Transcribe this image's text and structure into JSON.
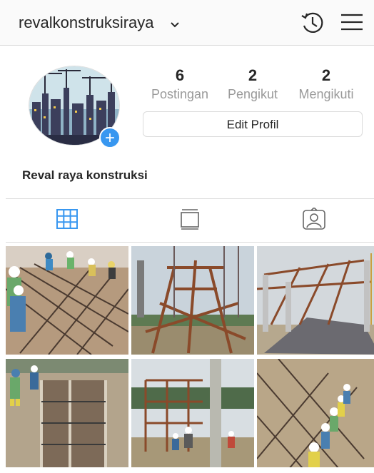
{
  "header": {
    "username": "revalkonstruksiraya"
  },
  "icons": {
    "chevron": "chevron-down-icon",
    "history": "history-icon",
    "menu": "hamburger-menu-icon",
    "add_story": "plus-icon",
    "grid_tab": "grid-icon",
    "igtv_tab": "tv-icon",
    "tagged_tab": "tagged-person-icon"
  },
  "profile": {
    "stats": [
      {
        "value": "6",
        "label": "Postingan"
      },
      {
        "value": "2",
        "label": "Pengikut"
      },
      {
        "value": "2",
        "label": "Mengikuti"
      }
    ],
    "edit_label": "Edit Profil",
    "name": "Reval raya konstruksi"
  },
  "colors": {
    "accent": "#3897f0",
    "border": "#dbdbdb",
    "muted": "#999999"
  },
  "posts": [
    {
      "desc": "workers tying rebar"
    },
    {
      "desc": "wooden formwork scaffolding"
    },
    {
      "desc": "scaffolding and gravel pile"
    },
    {
      "desc": "concrete formwork trench"
    },
    {
      "desc": "columns and workers on site"
    },
    {
      "desc": "workers on rebar mesh"
    }
  ]
}
